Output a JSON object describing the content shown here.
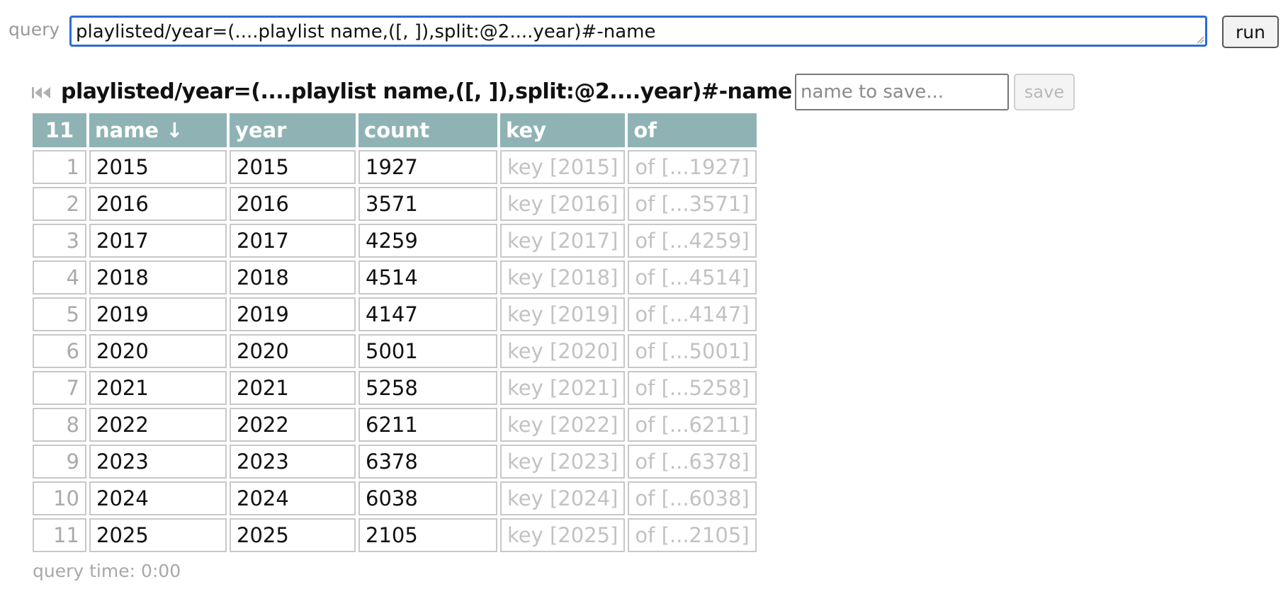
{
  "query": {
    "label": "query",
    "value": "playlisted/year=(....playlist name,([, ]),split:@2....year)#-name",
    "run_label": "run"
  },
  "result": {
    "title": "playlisted/year=(....playlist name,([, ]),split:@2....year)#-name",
    "save_placeholder": "name to save...",
    "save_label": "save",
    "first_icon": "skip-to-first-icon"
  },
  "table": {
    "headers": {
      "index": "11",
      "name": "name ↓",
      "year": "year",
      "count": "count",
      "key": "key",
      "of": "of"
    },
    "rows": [
      {
        "index": "1",
        "name": "2015",
        "year": "2015",
        "count": "1927",
        "key": "key [2015]",
        "of": "of [...1927]"
      },
      {
        "index": "2",
        "name": "2016",
        "year": "2016",
        "count": "3571",
        "key": "key [2016]",
        "of": "of [...3571]"
      },
      {
        "index": "3",
        "name": "2017",
        "year": "2017",
        "count": "4259",
        "key": "key [2017]",
        "of": "of [...4259]"
      },
      {
        "index": "4",
        "name": "2018",
        "year": "2018",
        "count": "4514",
        "key": "key [2018]",
        "of": "of [...4514]"
      },
      {
        "index": "5",
        "name": "2019",
        "year": "2019",
        "count": "4147",
        "key": "key [2019]",
        "of": "of [...4147]"
      },
      {
        "index": "6",
        "name": "2020",
        "year": "2020",
        "count": "5001",
        "key": "key [2020]",
        "of": "of [...5001]"
      },
      {
        "index": "7",
        "name": "2021",
        "year": "2021",
        "count": "5258",
        "key": "key [2021]",
        "of": "of [...5258]"
      },
      {
        "index": "8",
        "name": "2022",
        "year": "2022",
        "count": "6211",
        "key": "key [2022]",
        "of": "of [...6211]"
      },
      {
        "index": "9",
        "name": "2023",
        "year": "2023",
        "count": "6378",
        "key": "key [2023]",
        "of": "of [...6378]"
      },
      {
        "index": "10",
        "name": "2024",
        "year": "2024",
        "count": "6038",
        "key": "key [2024]",
        "of": "of [...6038]"
      },
      {
        "index": "11",
        "name": "2025",
        "year": "2025",
        "count": "2105",
        "key": "key [2025]",
        "of": "of [...2105]"
      }
    ]
  },
  "footer": {
    "query_time": "query time: 0:00"
  },
  "colors": {
    "header_bg": "#8fb3b4",
    "focus_border": "#2d6bd6",
    "muted_text": "#c2c2c2"
  }
}
